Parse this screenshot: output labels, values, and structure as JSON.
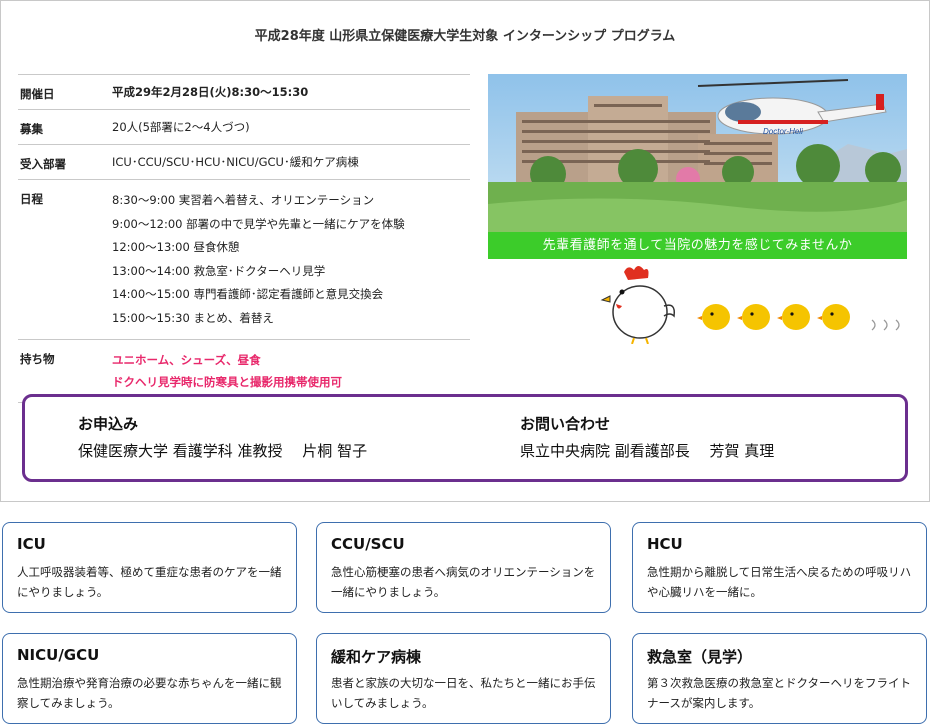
{
  "title": "平成28年度 山形県立保健医療大学生対象 インターンシップ プログラム",
  "info": {
    "date_label": "開催日",
    "date_value": "平成29年2月28日(火)8:30〜15:30",
    "recruit_label": "募集",
    "recruit_value": "20人(5部署に2〜4人づつ)",
    "dept_label": "受入部署",
    "dept_value": "ICU･CCU/SCU･HCU･NICU/GCU･緩和ケア病棟",
    "schedule_label": "日程",
    "schedule": [
      "8:30〜9:00 実習着へ着替え、オリエンテーション",
      "9:00〜12:00 部署の中で見学や先輩と一緒にケアを体験",
      "12:00〜13:00 昼食休憩",
      "13:00〜14:00 救急室･ドクターヘリ見学",
      "14:00〜15:00 専門看護師･認定看護師と意見交換会",
      "15:00〜15:30 まとめ、着替え"
    ],
    "items_label": "持ち物",
    "items_line1": "ユニホーム、シューズ、昼食",
    "items_line2": "ドクヘリ見学時に防寒具と撮影用携帯使用可"
  },
  "photo": {
    "heli_label": "Doctor-Heli",
    "banner": "先輩看護師を通して当院の魅力を感じてみませんか"
  },
  "contact": {
    "apply_heading": "お申込み",
    "apply_body": "保健医療大学 看護学科 准教授　 片桐 智子",
    "inquiry_heading": "お問い合わせ",
    "inquiry_body": "県立中央病院 副看護部長　 芳賀 真理"
  },
  "units": [
    {
      "name": "ICU",
      "desc": "人工呼吸器装着等、極めて重症な患者のケアを一緒にやりましょう。"
    },
    {
      "name": "CCU/SCU",
      "desc": "急性心筋梗塞の患者へ病気のオリエンテーションを一緒にやりましょう。"
    },
    {
      "name": "HCU",
      "desc": "急性期から離脱して日常生活へ戻るための呼吸リハや心臓リハを一緒に。"
    },
    {
      "name": "NICU/GCU",
      "desc": "急性期治療や発育治療の必要な赤ちゃんを一緒に観察してみましょう。"
    },
    {
      "name": "緩和ケア病棟",
      "desc": "患者と家族の大切な一日を、私たちと一緒にお手伝いしてみましょう。"
    },
    {
      "name": "救急室（見学）",
      "desc": "第３次救急医療の救急室とドクターヘリをフライトナースが案内します。"
    }
  ],
  "colors": {
    "accent_red": "#e60012",
    "accent_pink": "#e8286b",
    "banner_green": "#3ccc2a",
    "contact_border": "#6b2f8e",
    "card_border": "#3e6fae"
  },
  "icons": [
    "hospital-photo",
    "doctor-heli",
    "rooster-icon",
    "chick-icon"
  ]
}
